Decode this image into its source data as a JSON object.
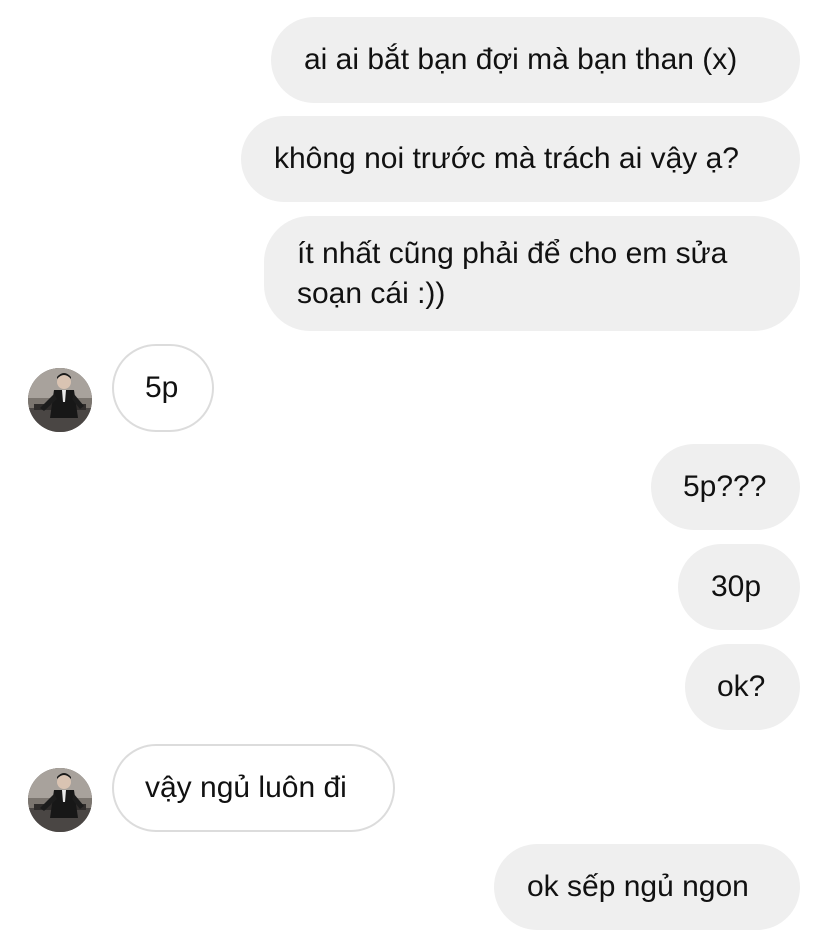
{
  "messages": [
    {
      "direction": "outgoing",
      "text": "ai ai bắt bạn đợi mà bạn than (x)"
    },
    {
      "direction": "outgoing",
      "text": "không noi trước mà trách ai vậy ạ?"
    },
    {
      "direction": "outgoing",
      "text": "ít nhất cũng phải để cho em sửa soạn cái :))"
    },
    {
      "direction": "incoming",
      "text": "5p"
    },
    {
      "direction": "outgoing",
      "text": "5p???"
    },
    {
      "direction": "outgoing",
      "text": "30p"
    },
    {
      "direction": "outgoing",
      "text": "ok?"
    },
    {
      "direction": "incoming",
      "text": "vậy ngủ luôn đi"
    },
    {
      "direction": "outgoing",
      "text": "ok sếp ngủ ngon"
    }
  ],
  "colors": {
    "outgoing_bubble": "#efefef",
    "incoming_bubble": "#ffffff",
    "incoming_border": "#dcdcdc",
    "text": "#111111"
  },
  "icons": {
    "avatar": "contact-avatar-photo"
  }
}
